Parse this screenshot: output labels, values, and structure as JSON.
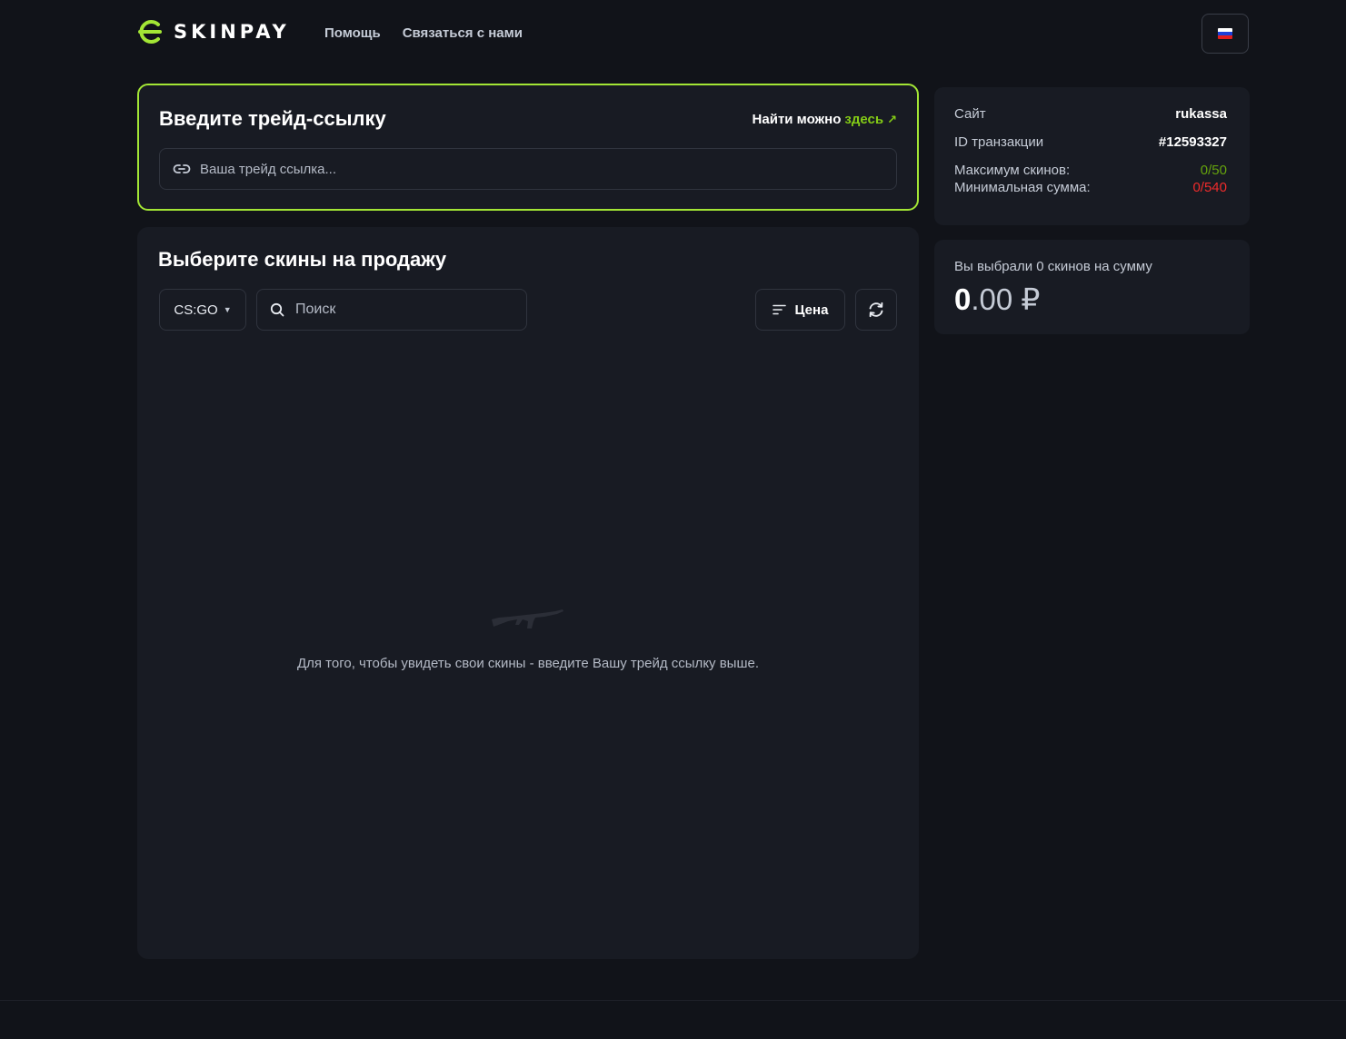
{
  "brand": {
    "name": "SKINPAY",
    "accent": "#a3e635"
  },
  "nav": {
    "help": "Помощь",
    "contact": "Связаться с нами"
  },
  "language": {
    "flag": "ru-flag-icon"
  },
  "trade": {
    "title": "Введите трейд-ссылку",
    "hint_prefix": "Найти можно",
    "hint_link": "здесь",
    "hint_arrow": "↗",
    "input_placeholder": "Ваша трейд ссылка..."
  },
  "info": {
    "site_label": "Сайт",
    "site_value": "rukassa",
    "tx_label": "ID транзакции",
    "tx_value": "#12593327",
    "max_skins_label": "Максимум скинов:",
    "max_skins_value": "0/50",
    "min_sum_label": "Минимальная сумма:",
    "min_sum_value": "0/540"
  },
  "summary": {
    "label": "Вы выбрали 0 скинов на сумму",
    "amount_int": "0",
    "amount_frac": ".00 ₽"
  },
  "skins": {
    "title": "Выберите скины на продажу",
    "game": "CS:GO",
    "search_placeholder": "Поиск",
    "sort_label": "Цена",
    "empty_text": "Для того, чтобы увидеть свои скины - введите Вашу трейд ссылку выше."
  }
}
